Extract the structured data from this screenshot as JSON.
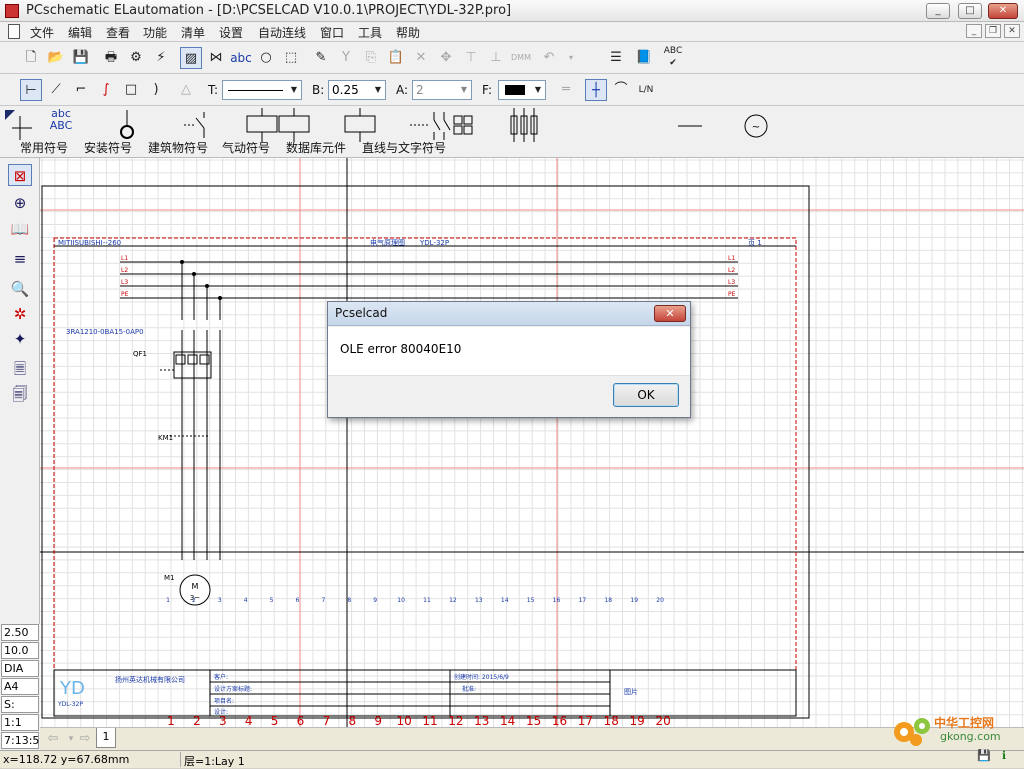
{
  "window": {
    "title": "PCschematic ELautomation - [D:\\PCSELCAD V10.0.1\\PROJECT\\YDL-32P.pro]",
    "min": "_",
    "max": "□",
    "close": "✕"
  },
  "menu": {
    "items": [
      "文件",
      "编辑",
      "查看",
      "功能",
      "清单",
      "设置",
      "自动连线",
      "窗口",
      "工具",
      "帮助"
    ],
    "mdi_min": "_",
    "mdi_restore": "❐",
    "mdi_close": "✕"
  },
  "toolbar2": {
    "t_label": "T:",
    "b_label": "B:",
    "b_value": "0.25",
    "a_label": "A:",
    "a_value": "2",
    "f_label": "F:",
    "dmm": "DMM",
    "abc": "abc",
    "spell": "ABC"
  },
  "symbols": {
    "abc_top": "abc",
    "abc_bottom": "ABC",
    "tabs": [
      "常用符号",
      "安装符号",
      "建筑物符号",
      "气动符号",
      "数据库元件",
      "直线与文字符号"
    ]
  },
  "status_left": [
    "2.50",
    "10.0",
    "DIA",
    "A4",
    "S:",
    "1:1",
    "7:13:5"
  ],
  "page_tab": "1",
  "statusbar": {
    "coords": "x=118.72 y=67.68mm",
    "layer": "层=1:Lay 1"
  },
  "drawing": {
    "header_left": "MITIISUBISHI--260",
    "header_center": "电气原理图",
    "header_code": "YDL-32P",
    "header_right": "页 1",
    "bus_left": [
      "L1",
      "L2",
      "L3",
      "PE"
    ],
    "bus_right": [
      "L1",
      "L2",
      "L3",
      "PE"
    ],
    "part_no": "3RA1210-0BA15-0AP0",
    "qf": "QF1",
    "km": "KM1",
    "motor_ref": "M1",
    "motor_m": "M",
    "motor_3": "3~",
    "col_numbers_blue": [
      "1",
      "2",
      "3",
      "4",
      "5",
      "6",
      "7",
      "8",
      "9",
      "10",
      "11",
      "12",
      "13",
      "14",
      "15",
      "16",
      "17",
      "18",
      "19",
      "20"
    ],
    "col_numbers_red": [
      "1",
      "2",
      "3",
      "4",
      "5",
      "6",
      "7",
      "8",
      "9",
      "10",
      "11",
      "12",
      "13",
      "14",
      "15",
      "16",
      "17",
      "18",
      "19",
      "20"
    ],
    "tb_logo": "YD",
    "tb_code": "YDL-32P",
    "tb_company": "扬州英达机械有限公司",
    "tb_c1": "客户:",
    "tb_c2": "设计方案标题:",
    "tb_c3": "项目名:",
    "tb_c4": "设计:",
    "tb_date": "创建时间: 2015/6/9",
    "tb_approve": "批准:",
    "tb_pic": "图片"
  },
  "dialog": {
    "title": "Pcselcad",
    "message": "OLE error 80040E10",
    "ok": "OK",
    "close": "✕"
  },
  "watermark": {
    "cn": "中华工控网",
    "url": "gkong.com"
  }
}
